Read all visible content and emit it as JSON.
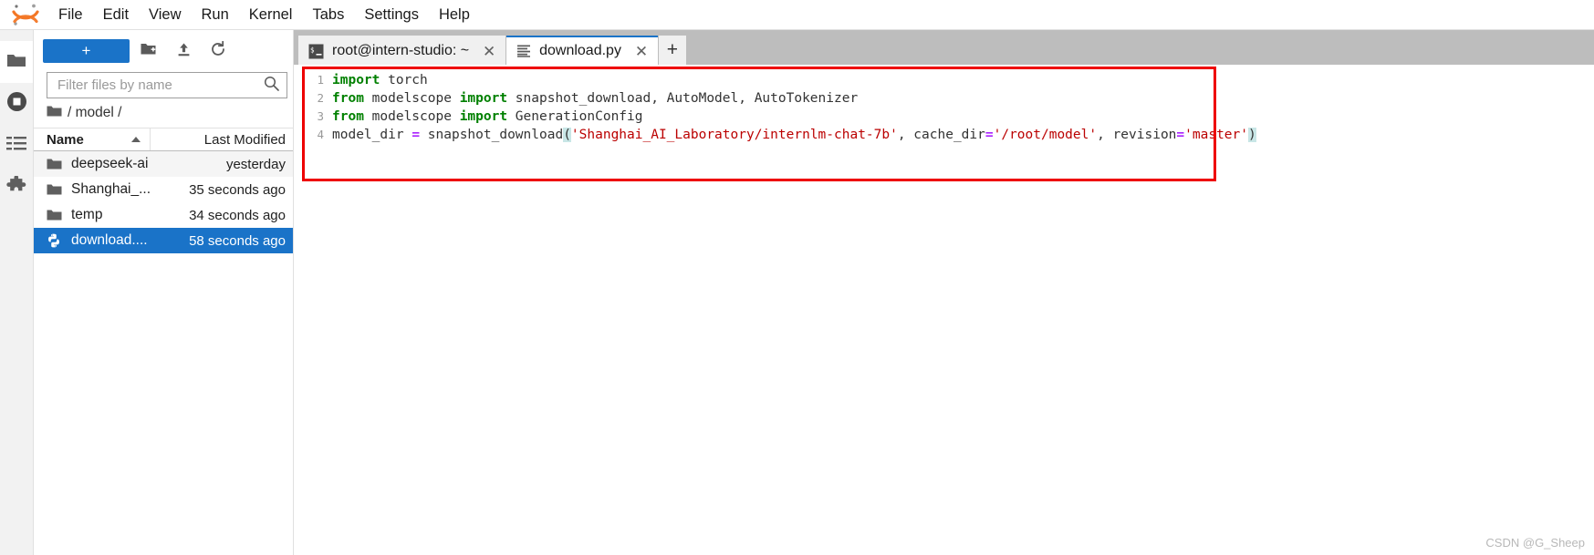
{
  "app": {
    "logo_icon": "jupyter-logo-icon",
    "watermark": "CSDN @G_Sheep"
  },
  "menubar": {
    "items": [
      {
        "label": "File"
      },
      {
        "label": "Edit"
      },
      {
        "label": "View"
      },
      {
        "label": "Run"
      },
      {
        "label": "Kernel"
      },
      {
        "label": "Tabs"
      },
      {
        "label": "Settings"
      },
      {
        "label": "Help"
      }
    ]
  },
  "activitybar": {
    "items": [
      {
        "name": "file-browser",
        "icon": "folder-icon",
        "active": true
      },
      {
        "name": "running-terminals",
        "icon": "stop-circle-icon",
        "active": false
      },
      {
        "name": "table-of-contents",
        "icon": "list-icon",
        "active": false
      },
      {
        "name": "extension-manager",
        "icon": "puzzle-icon",
        "active": false
      }
    ]
  },
  "filebrowser": {
    "new_launcher_label": "+",
    "toolbar": [
      {
        "name": "new-folder-button",
        "icon": "new-folder-icon"
      },
      {
        "name": "upload-button",
        "icon": "upload-icon"
      },
      {
        "name": "refresh-button",
        "icon": "refresh-icon"
      }
    ],
    "filter": {
      "placeholder": "Filter files by name",
      "value": "",
      "icon": "search-icon"
    },
    "breadcrumb": {
      "home_icon": "folder-icon",
      "path": "/ model /"
    },
    "columns": {
      "name": "Name",
      "last_modified": "Last Modified",
      "sort_icon": "caret-up-icon"
    },
    "rows": [
      {
        "name": "deepseek-ai",
        "modified": "yesterday",
        "icon": "folder-icon",
        "type": "directory",
        "selected": false
      },
      {
        "name": "Shanghai_...",
        "modified": "35 seconds ago",
        "icon": "folder-icon",
        "type": "directory",
        "selected": false
      },
      {
        "name": "temp",
        "modified": "34 seconds ago",
        "icon": "folder-icon",
        "type": "directory",
        "selected": false
      },
      {
        "name": "download....",
        "modified": "58 seconds ago",
        "icon": "python-file-icon",
        "type": "file",
        "selected": true
      }
    ]
  },
  "tabbar": {
    "tabs": [
      {
        "label": "root@intern-studio: ~",
        "icon": "terminal-icon",
        "active": false,
        "closable": true
      },
      {
        "label": "download.py",
        "icon": "text-file-icon",
        "active": true,
        "closable": true
      }
    ],
    "add_tab_label": "+"
  },
  "editor": {
    "lines": [
      {
        "number": "1",
        "tokens": [
          {
            "t": "import",
            "c": "kw"
          },
          {
            "t": " torch",
            "c": "plain"
          }
        ]
      },
      {
        "number": "2",
        "tokens": [
          {
            "t": "from",
            "c": "kw"
          },
          {
            "t": " modelscope ",
            "c": "plain"
          },
          {
            "t": "import",
            "c": "kw"
          },
          {
            "t": " snapshot_download, AutoModel, AutoTokenizer",
            "c": "plain"
          }
        ]
      },
      {
        "number": "3",
        "tokens": [
          {
            "t": "from",
            "c": "kw"
          },
          {
            "t": " modelscope ",
            "c": "plain"
          },
          {
            "t": "import",
            "c": "kw"
          },
          {
            "t": " GenerationConfig",
            "c": "plain"
          }
        ]
      },
      {
        "number": "4",
        "tokens": [
          {
            "t": "model_dir ",
            "c": "plain"
          },
          {
            "t": "=",
            "c": "op"
          },
          {
            "t": " snapshot_download",
            "c": "plain"
          },
          {
            "t": "(",
            "c": "brk"
          },
          {
            "t": "'Shanghai_AI_Laboratory/internlm-chat-7b'",
            "c": "str"
          },
          {
            "t": ", cache_dir",
            "c": "plain"
          },
          {
            "t": "=",
            "c": "op"
          },
          {
            "t": "'/root/model'",
            "c": "str"
          },
          {
            "t": ", revision",
            "c": "plain"
          },
          {
            "t": "=",
            "c": "op"
          },
          {
            "t": "'master'",
            "c": "str"
          },
          {
            "t": ")",
            "c": "brk"
          }
        ]
      }
    ],
    "annotation": {
      "name": "red-highlight-rectangle",
      "color": "#ee0000"
    }
  },
  "colors": {
    "accent": "#1a73c8",
    "keyword": "#008000",
    "string": "#bb0000",
    "operator": "#aa22ff",
    "annotation": "#ee0000",
    "tabbar_bg": "#bdbdbd"
  }
}
